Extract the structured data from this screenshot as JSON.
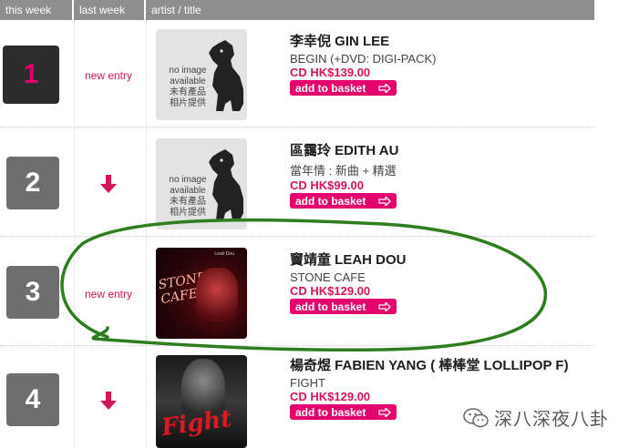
{
  "header": {
    "this_week": "this week",
    "last_week": "last week",
    "artist_title": "artist / title"
  },
  "placeholder": {
    "line1": "no image",
    "line2": "available",
    "line3": "未有產品",
    "line4": "相片提供"
  },
  "rows": [
    {
      "rank": "1",
      "last_week": "new entry",
      "last_week_type": "new",
      "artist": "李幸倪 GIN LEE",
      "title": "BEGIN (+DVD: DIGI-PACK)",
      "price": "CD HK$139.00",
      "basket": "add to basket",
      "cover": "no-image"
    },
    {
      "rank": "2",
      "last_week": "",
      "last_week_type": "down",
      "artist": "區靄玲 EDITH AU",
      "title": "當年情 : 新曲 + 精選",
      "price": "CD HK$99.00",
      "basket": "add to basket",
      "cover": "no-image"
    },
    {
      "rank": "3",
      "last_week": "new entry",
      "last_week_type": "new",
      "artist": "竇靖童 LEAH DOU",
      "title": "STONE CAFE",
      "price": "CD HK$129.00",
      "basket": "add to basket",
      "cover": "stone-cafe",
      "cover_text": "STONE CAFE",
      "cover_small": "Leah Dou"
    },
    {
      "rank": "4",
      "last_week": "",
      "last_week_type": "down",
      "artist": "楊奇煜 FABIEN YANG ( 棒棒堂 LOLLIPOP F)",
      "title": "FIGHT",
      "price": "CD HK$129.00",
      "basket": "add to basket",
      "cover": "fight",
      "cover_text": "Fight"
    }
  ],
  "watermark": {
    "text": "深八深夜八卦"
  },
  "colors": {
    "accent": "#e4006d",
    "header_bg": "#8e8e8e",
    "rank_bg": "#6e6e6e",
    "highlight_circle": "#2e7d1e"
  }
}
